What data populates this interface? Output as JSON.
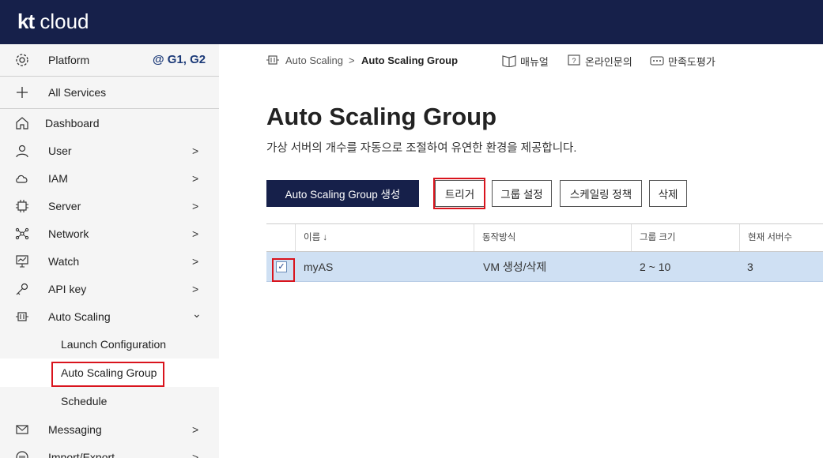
{
  "header": {
    "logo_mark": "kt",
    "logo_text": "cloud"
  },
  "sidebar": {
    "platform_label": "Platform",
    "region": "@ G1, G2",
    "all_services": "All Services",
    "items": [
      {
        "label": "Dashboard",
        "icon": "home-icon"
      },
      {
        "label": "User",
        "icon": "user-icon",
        "chevron": ">"
      },
      {
        "label": "IAM",
        "icon": "cloud-lock-icon",
        "chevron": ">"
      },
      {
        "label": "Server",
        "icon": "chip-icon",
        "chevron": ">"
      },
      {
        "label": "Network",
        "icon": "network-icon",
        "chevron": ">"
      },
      {
        "label": "Watch",
        "icon": "monitor-icon",
        "chevron": ">"
      },
      {
        "label": "API key",
        "icon": "key-icon",
        "chevron": ">"
      },
      {
        "label": "Auto Scaling",
        "icon": "autoscaling-icon",
        "chevron": "⌄"
      },
      {
        "label": "Messaging",
        "icon": "mail-icon",
        "chevron": ">"
      },
      {
        "label": "Import/Export",
        "icon": "transfer-icon",
        "chevron": ">"
      }
    ],
    "sub_items": [
      {
        "label": "Launch Configuration"
      },
      {
        "label": "Auto Scaling Group"
      },
      {
        "label": "Schedule"
      }
    ]
  },
  "breadcrumb": {
    "parent": "Auto Scaling",
    "separator": ">",
    "current": "Auto Scaling Group"
  },
  "top_links": {
    "manual": "매뉴얼",
    "inquiry": "온라인문의",
    "survey": "만족도평가"
  },
  "page": {
    "title": "Auto Scaling Group",
    "description": "가상 서버의 개수를 자동으로 조절하여 유연한 환경을 제공합니다."
  },
  "actions": {
    "create": "Auto Scaling Group 생성",
    "trigger": "트리거",
    "group_settings": "그룹 설정",
    "scaling_policy": "스케일링 정책",
    "delete": "삭제"
  },
  "table": {
    "columns": [
      "이름 ↓",
      "동작방식",
      "그룹 크기",
      "현재 서버수"
    ],
    "rows": [
      {
        "checked": "✓",
        "name": "myAS",
        "mode": "VM 생성/삭제",
        "size": "2 ~ 10",
        "current": "3"
      }
    ]
  },
  "colors": {
    "header_bg": "#16204a",
    "accent": "#16204a",
    "highlight": "#d9141d",
    "selected_row": "#cfe0f3"
  }
}
